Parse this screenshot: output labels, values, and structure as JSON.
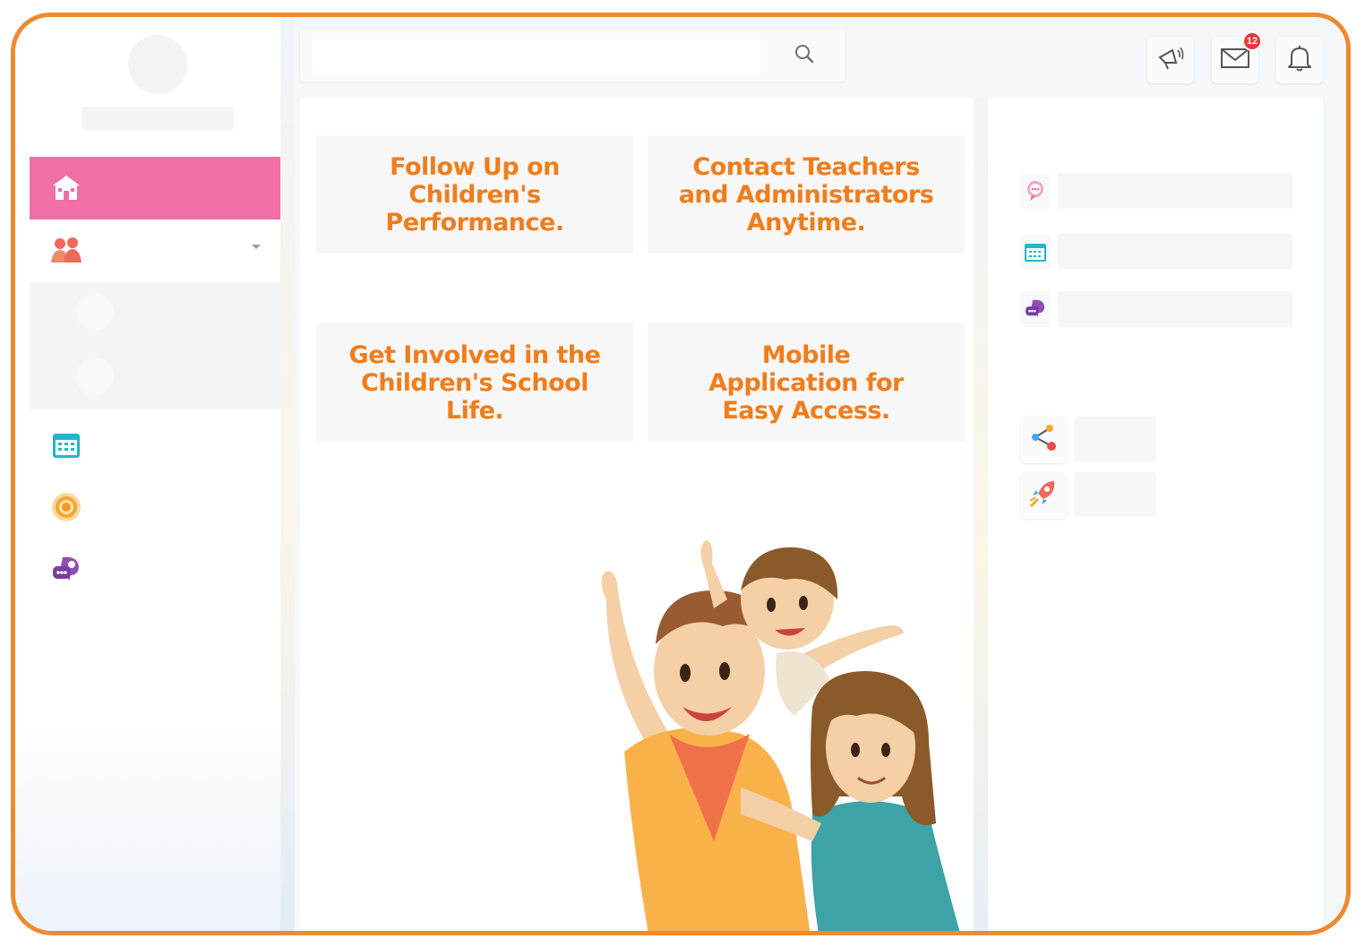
{
  "features": [
    {
      "text": "Follow Up on Children's Performance."
    },
    {
      "text": "Contact Teachers and Administrators Anytime."
    },
    {
      "text": "Get Involved in the Children's School Life."
    },
    {
      "text": "Mobile Application for Easy Access."
    }
  ],
  "header": {
    "messages_badge": "12"
  },
  "icons": {
    "sidebar": [
      "school-icon",
      "family-icon",
      "calendar-icon",
      "target-icon",
      "chat-icon"
    ],
    "topbar": [
      "search-icon",
      "megaphone-icon",
      "mail-icon",
      "bell-icon"
    ],
    "right_panel": [
      "chat-bubble-icon",
      "calendar-icon",
      "chat-icon",
      "share-icon",
      "rocket-icon"
    ]
  },
  "colors": {
    "accent_pink": "#ef6fa6",
    "feature_text": "#f07d1c",
    "frame_border": "#ef8a2d",
    "badge": "#e53935"
  }
}
